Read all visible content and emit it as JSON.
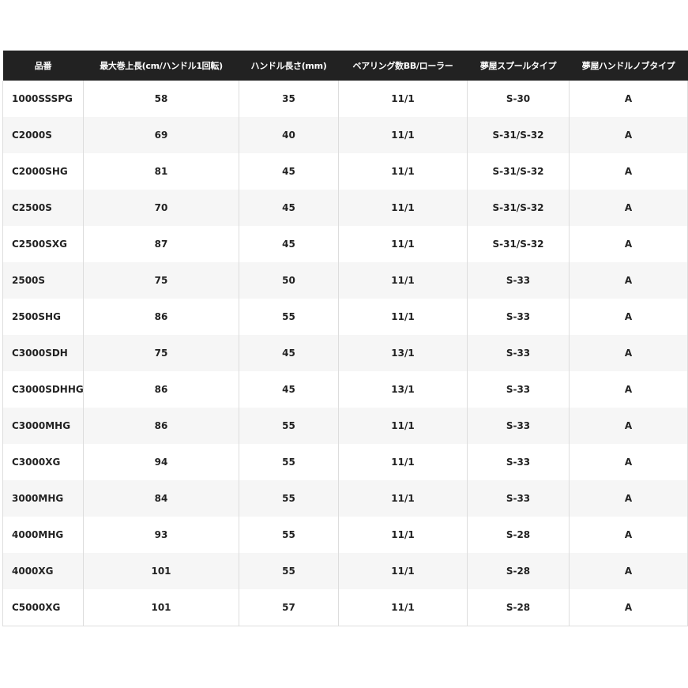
{
  "table": {
    "headers": [
      "品番",
      "最大巻上長(cm/ハンドル1回転)",
      "ハンドル長さ(mm)",
      "ベアリング数BB/ローラー",
      "夢屋スプールタイプ",
      "夢屋ハンドルノブタイプ"
    ],
    "rows": [
      [
        "1000SSSPG",
        "58",
        "35",
        "11/1",
        "S-30",
        "A"
      ],
      [
        "C2000S",
        "69",
        "40",
        "11/1",
        "S-31/S-32",
        "A"
      ],
      [
        "C2000SHG",
        "81",
        "45",
        "11/1",
        "S-31/S-32",
        "A"
      ],
      [
        "C2500S",
        "70",
        "45",
        "11/1",
        "S-31/S-32",
        "A"
      ],
      [
        "C2500SXG",
        "87",
        "45",
        "11/1",
        "S-31/S-32",
        "A"
      ],
      [
        "2500S",
        "75",
        "50",
        "11/1",
        "S-33",
        "A"
      ],
      [
        "2500SHG",
        "86",
        "55",
        "11/1",
        "S-33",
        "A"
      ],
      [
        "C3000SDH",
        "75",
        "45",
        "13/1",
        "S-33",
        "A"
      ],
      [
        "C3000SDHHG",
        "86",
        "45",
        "13/1",
        "S-33",
        "A"
      ],
      [
        "C3000MHG",
        "86",
        "55",
        "11/1",
        "S-33",
        "A"
      ],
      [
        "C3000XG",
        "94",
        "55",
        "11/1",
        "S-33",
        "A"
      ],
      [
        "3000MHG",
        "84",
        "55",
        "11/1",
        "S-33",
        "A"
      ],
      [
        "4000MHG",
        "93",
        "55",
        "11/1",
        "S-28",
        "A"
      ],
      [
        "4000XG",
        "101",
        "55",
        "11/1",
        "S-28",
        "A"
      ],
      [
        "C5000XG",
        "101",
        "57",
        "11/1",
        "S-28",
        "A"
      ]
    ]
  }
}
